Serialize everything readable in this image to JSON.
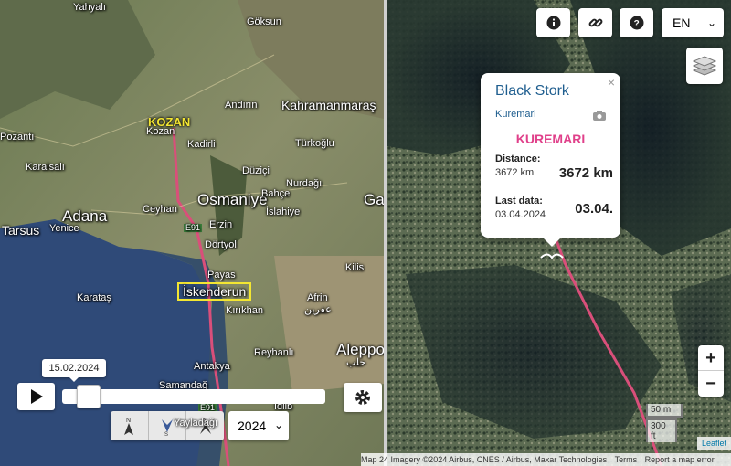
{
  "left_map": {
    "places": {
      "yahyali": "Yahyalı",
      "goksun": "Göksun",
      "kozan_highlight": "KOZAN",
      "kozan": "Kozan",
      "andirin": "Andırın",
      "kahramanmaras": "Kahramanmaraş",
      "pozanti": "Pozantı",
      "kadirli": "Kadirli",
      "turkoglu": "Türkoğlu",
      "karaisali": "Karaisalı",
      "duzici": "Düziçi",
      "osmaniye": "Osmaniye",
      "bahce": "Bahçe",
      "nurdagi": "Nurdağı",
      "ga": "Ga",
      "adana": "Adana",
      "ceyhan": "Ceyhan",
      "erzin": "Erzin",
      "islahiye": "İslahiye",
      "tarsus": "Tarsus",
      "yenice": "Yenice",
      "e91_top": "E91",
      "dortyol": "Dörtyol",
      "kilis": "Kilis",
      "payas": "Payas",
      "iskenderun": "İskenderun",
      "karatas": "Karataş",
      "afrin": "Afrin",
      "afrin_ar": "عفرين",
      "kirikhan": "Kırıkhan",
      "reyhanli": "Reyhanlı",
      "aleppo": "Aleppo",
      "aleppo_ar": "حلب",
      "antakya": "Antakya",
      "samandag": "Samandağ",
      "e91_bottom": "E91",
      "idlib": "Idlib",
      "yayladagi": "Yayladağı"
    },
    "player": {
      "date": "15.02.2024",
      "year": "2024",
      "progress_fraction": 0.06
    },
    "icons": [
      "play-icon",
      "gear-icon",
      "north-arrow-icon",
      "bird-north-icon",
      "bird-south-icon"
    ]
  },
  "right_map": {
    "toolbar": {
      "info_icon": "info-icon",
      "link_icon": "link-icon",
      "help_icon": "help-icon",
      "language": "EN"
    },
    "popup": {
      "title": "Black Stork",
      "close": "×",
      "location_link": "Kuremari",
      "name": "KUREMARI",
      "distance_label": "Distance:",
      "distance_small": "3672 km",
      "distance_big": "3672 km",
      "last_data_label": "Last data:",
      "last_data_small": "03.04.2024",
      "last_data_big": "03.04."
    },
    "zoom": {
      "in": "+",
      "out": "−"
    },
    "scale": {
      "metric": "50 m",
      "imperial": "300 ft"
    },
    "attribution": {
      "prefix": "Map",
      "text": "24 Imagery ©2024 Airbus, CNES / Airbus, Maxar Technologies",
      "terms": "Terms",
      "report": "Report a map error",
      "leaflet": "Leaflet"
    }
  },
  "colors": {
    "track": "#d94f7a",
    "popup_title": "#1f5e8f",
    "popup_name": "#e0408a",
    "highlight": "#f3e632"
  }
}
